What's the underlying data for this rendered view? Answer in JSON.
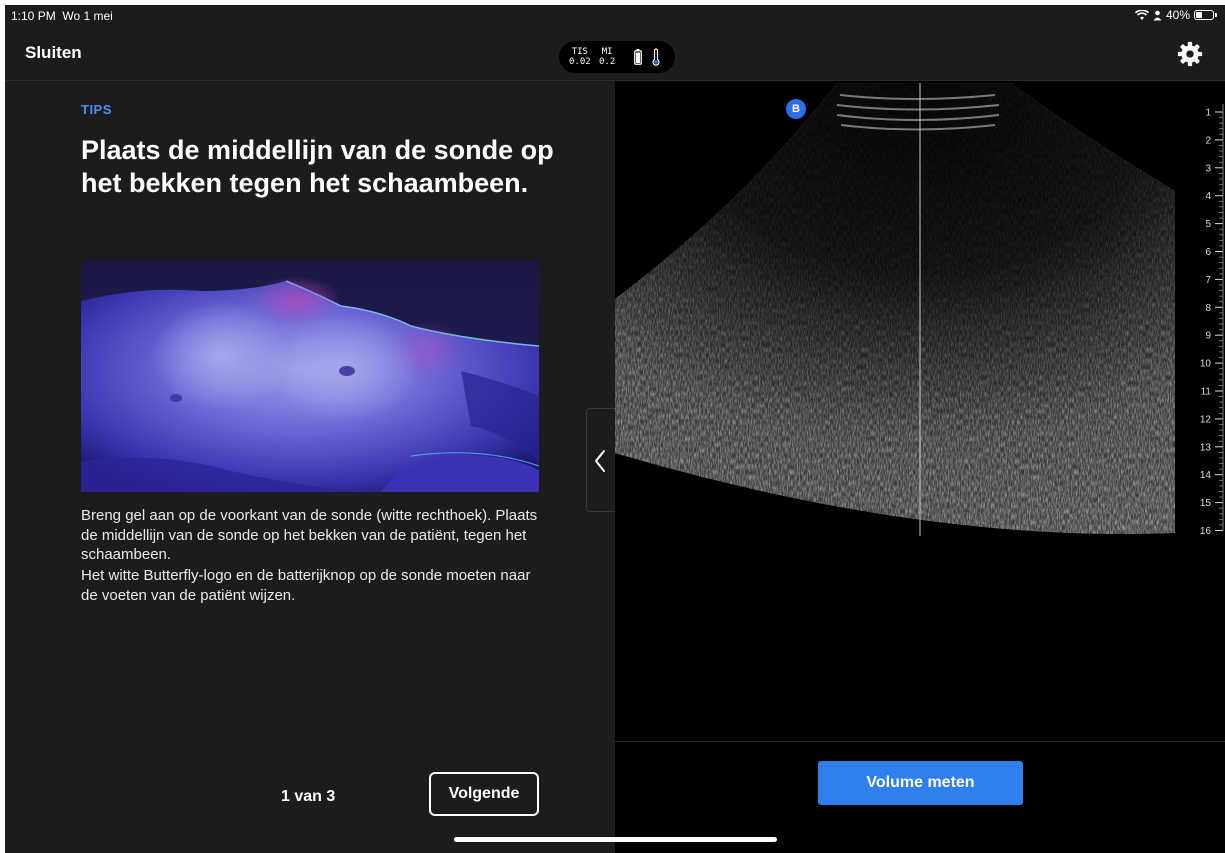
{
  "status_bar": {
    "time": "1:10 PM",
    "date": "Wo 1 mei",
    "battery_text": "40%",
    "battery_level": 0.4
  },
  "nav": {
    "close_label": "Sluiten",
    "tis_label": "TIS",
    "tis_value": "0.02",
    "mi_label": "MI",
    "mi_value": "0.2",
    "settings_icon": "gear-icon"
  },
  "tip": {
    "section_label": "TIPS",
    "title": "Plaats de middellijn van de sonde op het bekken tegen het schaambeen.",
    "paragraph_1": "Breng gel aan op de voorkant van de sonde (witte rechthoek). Plaats de middellijn van de sonde op het bekken van de patiënt, tegen het schaambeen.",
    "paragraph_2": "Het witte Butterfly-logo en de batterijknop op de sonde moeten naar de voeten van de patiënt wijzen.",
    "pager": "1 van 3",
    "next_label": "Volgende"
  },
  "scan": {
    "mode_badge": "B",
    "depth_labels": [
      "1",
      "2",
      "3",
      "4",
      "5",
      "6",
      "7",
      "8",
      "9",
      "10",
      "11",
      "12",
      "13",
      "14",
      "15",
      "16"
    ],
    "volume_button": "Volume meten"
  },
  "colors": {
    "accent": "#2f80ed",
    "tips_blue": "#4a90f0",
    "panel_bg": "#1c1c1e",
    "scan_bg": "#000000"
  }
}
